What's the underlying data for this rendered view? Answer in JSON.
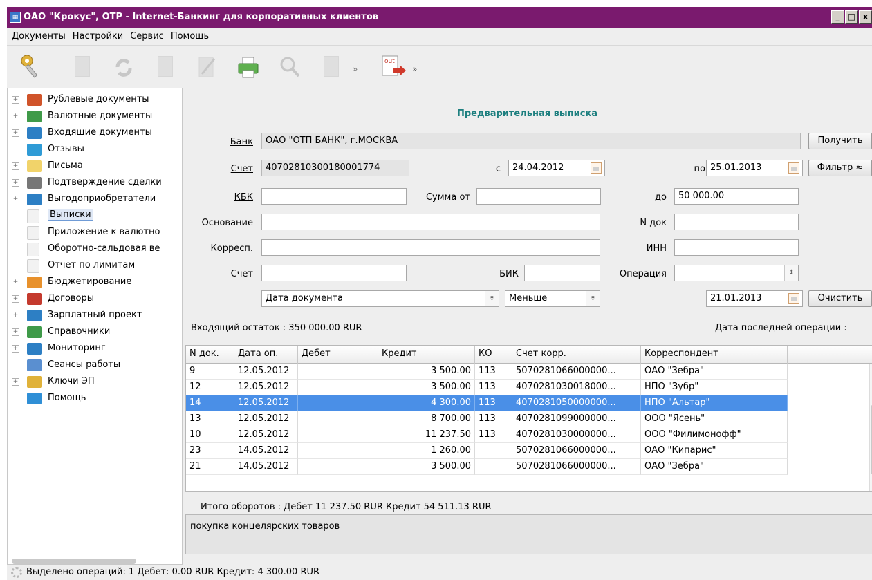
{
  "window": {
    "title": "ОАО \"Крокус\", ОТР - Internet-Банкинг для корпоративных клиентов",
    "buttons": [
      "_",
      "□",
      "x"
    ]
  },
  "menu": [
    "Документы",
    "Настройки",
    "Сервис",
    "Помощь"
  ],
  "toolbar": {
    "export_label": "out",
    "icons": [
      "keys-icon",
      "new-document-icon",
      "refresh-icon",
      "delete-icon",
      "edit-icon",
      "print-icon",
      "search-icon",
      "import-icon",
      "export-icon"
    ]
  },
  "sidebar": {
    "items": [
      {
        "label": "Рублевые документы",
        "icon": "ruble-folder-icon",
        "color": "#d0542a",
        "expandable": true,
        "child": false
      },
      {
        "label": "Валютные документы",
        "icon": "currency-folder-icon",
        "color": "#3f9a49",
        "expandable": true,
        "child": false
      },
      {
        "label": "Входящие документы",
        "icon": "incoming-folder-icon",
        "color": "#2d7fc4",
        "expandable": true,
        "child": false
      },
      {
        "label": "Отзывы",
        "icon": "recall-icon",
        "color": "#2f9bd6",
        "expandable": false,
        "child": false
      },
      {
        "label": "Письма",
        "icon": "mail-icon",
        "color": "#f1d36a",
        "expandable": true,
        "child": false
      },
      {
        "label": "Подтверждение сделки",
        "icon": "confirm-icon",
        "color": "#777777",
        "expandable": true,
        "child": false
      },
      {
        "label": "Выгодоприобретатели",
        "icon": "folder-icon",
        "color": "#2d7fc4",
        "expandable": true,
        "child": false
      },
      {
        "label": "Выписки",
        "icon": "document-icon",
        "color": "#f2f2f2",
        "expandable": false,
        "child": true,
        "selected": true
      },
      {
        "label": "Приложение к валютно",
        "icon": "document-icon",
        "color": "#f2f2f2",
        "expandable": false,
        "child": true
      },
      {
        "label": "Оборотно-сальдовая ве",
        "icon": "document-icon",
        "color": "#f2f2f2",
        "expandable": false,
        "child": true
      },
      {
        "label": "Отчет по лимитам",
        "icon": "document-icon",
        "color": "#f2f2f2",
        "expandable": false,
        "child": true
      },
      {
        "label": "Бюджетирование",
        "icon": "chart-icon",
        "color": "#e8912c",
        "expandable": true,
        "child": false
      },
      {
        "label": "Договоры",
        "icon": "contract-icon",
        "color": "#c43a2e",
        "expandable": true,
        "child": false
      },
      {
        "label": "Зарплатный проект",
        "icon": "folder-icon",
        "color": "#2d7fc4",
        "expandable": true,
        "child": false
      },
      {
        "label": "Справочники",
        "icon": "book-icon",
        "color": "#3f9a49",
        "expandable": true,
        "child": false
      },
      {
        "label": "Мониторинг",
        "icon": "monitoring-icon",
        "color": "#2d7fc4",
        "expandable": true,
        "child": false
      },
      {
        "label": "Сеансы работы",
        "icon": "computer-icon",
        "color": "#5a8fd0",
        "expandable": false,
        "child": false
      },
      {
        "label": "Ключи ЭП",
        "icon": "keys-icon",
        "color": "#e0b23a",
        "expandable": true,
        "child": false
      },
      {
        "label": "Помощь",
        "icon": "help-icon",
        "color": "#2f8fd6",
        "expandable": false,
        "child": false
      }
    ]
  },
  "form": {
    "title": "Предварительная выписка",
    "bank_label": "Банк",
    "bank_value": "ОАО \"ОТП БАНК\", г.МОСКВА",
    "account_label": "Счет",
    "account_value": "40702810300180001774",
    "from_label": "с",
    "from_date": "24.04.2012",
    "to_label": "по",
    "to_date": "25.01.2013",
    "kbk_label": "КБК",
    "kbk_value": "",
    "sum_from_label": "Сумма от",
    "sum_from_value": "",
    "sum_to_label": "до",
    "sum_to_value": "50 000.00",
    "basis_label": "Основание",
    "basis_value": "",
    "ndoc_label": "N док",
    "ndoc_value": "",
    "corresp_label": "Корресп.",
    "corresp_value": "",
    "inn_label": "ИНН",
    "inn_value": "",
    "acc2_label": "Счет",
    "acc2_value": "",
    "bik_label": "БИК",
    "bik_value": "",
    "operation_label": "Операция",
    "operation_value": "",
    "date_type": "Дата документа",
    "comparison": "Меньше",
    "compare_date": "21.01.2013",
    "btn_get": "Получить",
    "btn_filter": "Фильтр ≈",
    "btn_clear": "Очистить"
  },
  "balance": {
    "incoming": "Входящий остаток : 350 000.00 RUR",
    "last_op": "Дата последней операции :"
  },
  "table": {
    "columns": [
      "N док.",
      "Дата оп.",
      "Дебет",
      "Кредит",
      "КО",
      "Счет корр.",
      "Корреспондент"
    ],
    "rows": [
      {
        "n": "9",
        "date": "12.05.2012",
        "debit": "",
        "credit": "3 500.00",
        "ko": "113",
        "acc": "5070281066000000...",
        "corr": "ОАО \"Зебра\""
      },
      {
        "n": "12",
        "date": "12.05.2012",
        "debit": "",
        "credit": "3 500.00",
        "ko": "113",
        "acc": "4070281030018000...",
        "corr": "НПО \"Зубр\""
      },
      {
        "n": "14",
        "date": "12.05.2012",
        "debit": "",
        "credit": "4 300.00",
        "ko": "113",
        "acc": "4070281050000000...",
        "corr": "НПО \"Альтар\"",
        "selected": true
      },
      {
        "n": "13",
        "date": "12.05.2012",
        "debit": "",
        "credit": "8 700.00",
        "ko": "113",
        "acc": "4070281099000000...",
        "corr": "ООО \"Ясень\""
      },
      {
        "n": "10",
        "date": "12.05.2012",
        "debit": "",
        "credit": "11 237.50",
        "ko": "113",
        "acc": "4070281030000000...",
        "corr": "ООО \"Филимонофф\""
      },
      {
        "n": "23",
        "date": "14.05.2012",
        "debit": "",
        "credit": "1 260.00",
        "ko": "",
        "acc": "5070281066000000...",
        "corr": "ОАО \"Кипарис\""
      },
      {
        "n": "21",
        "date": "14.05.2012",
        "debit": "",
        "credit": "3 500.00",
        "ko": "",
        "acc": "5070281066000000...",
        "corr": "ОАО \"Зебра\""
      }
    ]
  },
  "totals": "Итого оборотов : Дебет 11 237.50 RUR Кредит 54 511.13 RUR",
  "note": "покупка концелярских товаров",
  "status": "Выделено операций: 1 Дебет: 0.00 RUR Кредит: 4 300.00 RUR",
  "colors": {
    "titlebar": "#7a1a6e",
    "selection": "#4a8fe7",
    "title_accent": "#1d7f7f"
  }
}
